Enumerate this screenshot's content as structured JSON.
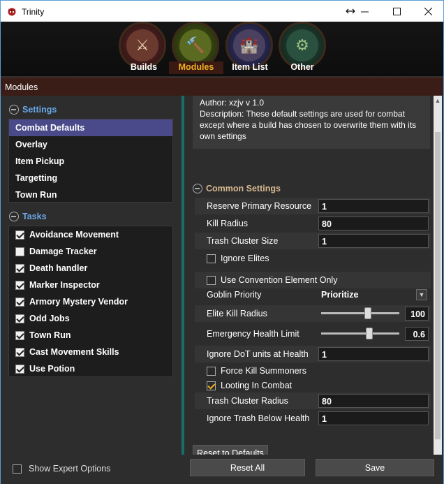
{
  "window": {
    "title": "Trinity",
    "controls": [
      "resize-icon",
      "minimize-icon",
      "maximize-icon",
      "close-icon"
    ]
  },
  "nav": {
    "tabs": [
      {
        "label": "Builds",
        "active": false
      },
      {
        "label": "Modules",
        "active": true
      },
      {
        "label": "Item List",
        "active": false
      },
      {
        "label": "Other",
        "active": false
      }
    ],
    "orbs": [
      "crossed-swords-icon",
      "hammer-icon",
      "castle-icon",
      "gear-icon"
    ]
  },
  "modules_header": "Modules",
  "settings_group": {
    "label": "Settings",
    "items": [
      "Combat Defaults",
      "Overlay",
      "Item Pickup",
      "Targetting",
      "Town Run"
    ],
    "selected": "Combat Defaults"
  },
  "tasks_group": {
    "label": "Tasks",
    "items": [
      {
        "label": "Avoidance Movement",
        "checked": true
      },
      {
        "label": "Damage Tracker",
        "checked": false
      },
      {
        "label": "Death handler",
        "checked": true
      },
      {
        "label": "Marker Inspector",
        "checked": true
      },
      {
        "label": "Armory Mystery Vendor",
        "checked": true
      },
      {
        "label": "Odd Jobs",
        "checked": true
      },
      {
        "label": "Town Run",
        "checked": true
      },
      {
        "label": "Cast Movement Skills",
        "checked": true
      },
      {
        "label": "Use Potion",
        "checked": true
      }
    ]
  },
  "description": {
    "author": "Author: xzjv    v 1.0",
    "text": "Description: These default settings are used for combat except where a build has chosen to overwrite them with its own settings"
  },
  "common_settings": {
    "label": "Common Settings",
    "reserve_primary_resource": {
      "label": "Reserve Primary Resource",
      "value": "1"
    },
    "kill_radius": {
      "label": "Kill Radius",
      "value": "80"
    },
    "trash_cluster_size": {
      "label": "Trash Cluster Size",
      "value": "1"
    },
    "ignore_elites": {
      "label": "Ignore Elites",
      "checked": false
    },
    "use_convention_element_only": {
      "label": "Use Convention Element Only",
      "checked": false
    },
    "goblin_priority": {
      "label": "Goblin Priority",
      "value": "Prioritize"
    },
    "elite_kill_radius": {
      "label": "Elite Kill Radius",
      "value": "100",
      "fraction": 0.6
    },
    "emergency_health_limit": {
      "label": "Emergency Health Limit",
      "value": "0.6",
      "fraction": 0.6
    },
    "ignore_dot_units": {
      "label": "Ignore DoT units at Health",
      "value": "1"
    },
    "force_kill_summoners": {
      "label": "Force Kill Summoners",
      "checked": false
    },
    "looting_in_combat": {
      "label": "Looting In Combat",
      "checked": true
    },
    "trash_cluster_radius": {
      "label": "Trash Cluster Radius",
      "value": "80"
    },
    "ignore_trash_below_health": {
      "label": "Ignore Trash Below Health",
      "value": "1"
    }
  },
  "buttons": {
    "reset_to_defaults": "Reset to Defaults",
    "reset_all": "Reset All",
    "save": "Save"
  },
  "show_expert_options": {
    "label": "Show Expert Options",
    "checked": false
  }
}
